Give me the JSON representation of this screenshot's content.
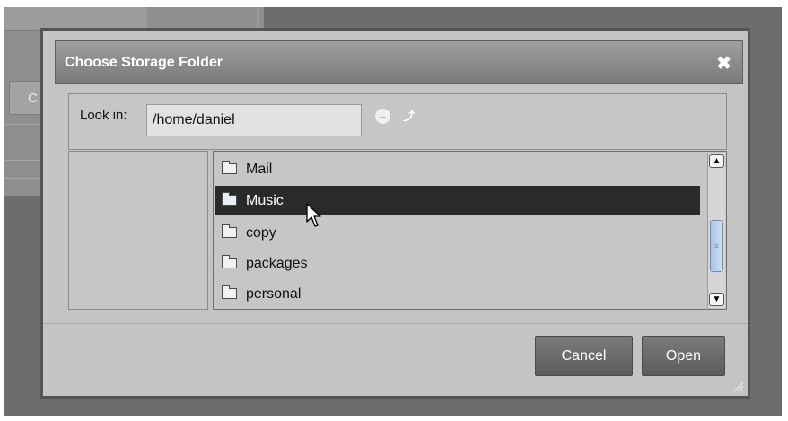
{
  "dialog": {
    "title": "Choose Storage Folder",
    "close_icon": "close-icon"
  },
  "background": {
    "button_label": "C"
  },
  "look_in": {
    "label": "Look in:",
    "path": "/home/daniel",
    "back_icon": "back-arrow-icon",
    "up_icon": "up-folder-icon"
  },
  "files": [
    {
      "name": "Mail",
      "selected": false
    },
    {
      "name": "Music",
      "selected": true
    },
    {
      "name": "copy",
      "selected": false
    },
    {
      "name": "packages",
      "selected": false
    },
    {
      "name": "personal",
      "selected": false
    }
  ],
  "buttons": {
    "cancel": "Cancel",
    "open": "Open"
  },
  "colors": {
    "selection": "#2a2a2a",
    "dialog_bg": "#c4c4c4",
    "titlebar": "#8b8b8b"
  }
}
